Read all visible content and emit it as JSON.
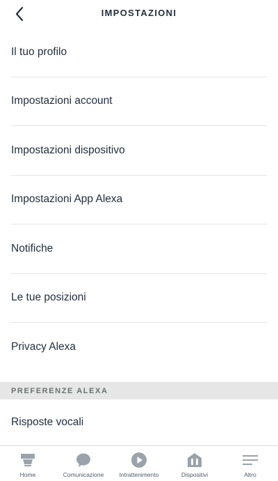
{
  "header": {
    "title": "IMPOSTAZIONI",
    "back_icon": "chevron-left-icon"
  },
  "settings": {
    "items": [
      {
        "label": "Il tuo profilo"
      },
      {
        "label": "Impostazioni account"
      },
      {
        "label": "Impostazioni dispositivo"
      },
      {
        "label": "Impostazioni App Alexa"
      },
      {
        "label": "Notifiche"
      },
      {
        "label": "Le tue posizioni"
      },
      {
        "label": "Privacy Alexa"
      }
    ]
  },
  "alexa_preferences": {
    "section_title": "PREFERENZE ALEXA",
    "items": [
      {
        "label": "Risposte vocali"
      }
    ]
  },
  "tabbar": {
    "tabs": [
      {
        "label": "Home",
        "icon": "home-icon"
      },
      {
        "label": "Comunicazione",
        "icon": "chat-bubble-icon"
      },
      {
        "label": "Intrattenimento",
        "icon": "play-icon"
      },
      {
        "label": "Dispositivi",
        "icon": "devices-house-icon"
      },
      {
        "label": "Altro",
        "icon": "menu-lines-icon"
      }
    ],
    "icon_color": "#9aa3ab"
  }
}
